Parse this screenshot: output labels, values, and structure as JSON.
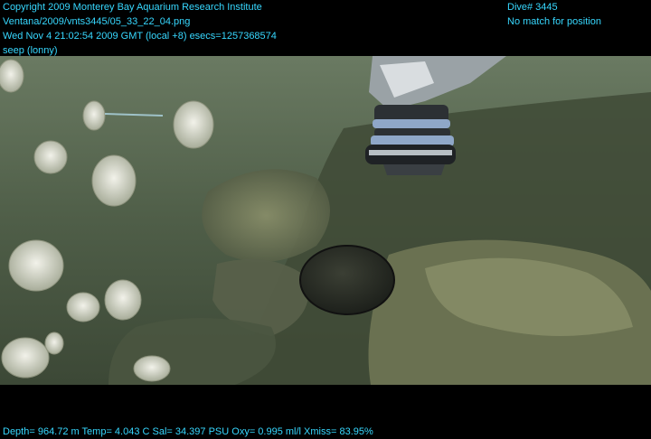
{
  "overlay": {
    "top_left": {
      "line1": "Copyright 2009 Monterey Bay Aquarium Research Institute",
      "line2": "Ventana/2009/vnts3445/05_33_22_04.png",
      "line3": "Wed Nov  4 21:02:54 2009 GMT (local +8)  esecs=1257368574",
      "line4": "seep (lonny)"
    },
    "top_right": {
      "line1": "Dive# 3445",
      "line2": "No match for position"
    },
    "bottom_left": {
      "line1": "Depth= 964.72 m  Temp= 4.043 C  Sal= 34.397 PSU  Oxy= 0.995 ml/l  Xmiss= 83.95%"
    }
  },
  "colors": {
    "overlay_text": "#37d8ff",
    "background": "#000000",
    "water": "#5b6a55"
  }
}
